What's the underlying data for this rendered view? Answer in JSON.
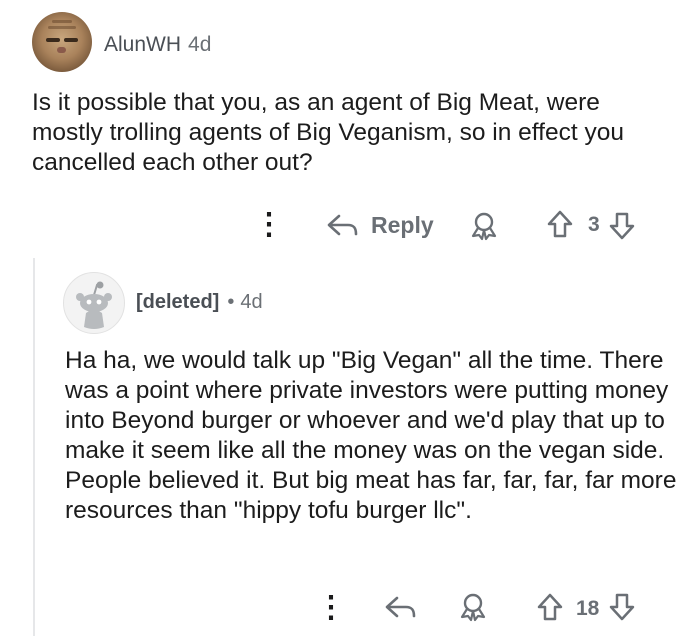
{
  "comment": {
    "username": "AlunWH",
    "age": "4d",
    "body": "Is it possible that you, as an agent of Big Meat, were mostly trolling agents of Big Veganism, so in effect you cancelled each other out?",
    "actions": {
      "more": "⋮",
      "reply_label": "Reply",
      "vote_count": "3"
    }
  },
  "reply": {
    "username": "[deleted]",
    "separator": "•",
    "age": "4d",
    "body": "Ha ha, we would talk up \"Big Vegan\" all the time. There was a point where private investors were putting money into Beyond burger or whoever and we'd play that up to make it seem like all the money was on the vegan side. People believed it. But big meat has far, far, far, far more resources than \"hippy tofu burger llc\".",
    "actions": {
      "more": "⋮",
      "vote_count": "18"
    }
  },
  "colors": {
    "text": "#1c1c1c",
    "meta": "#6a6f75",
    "thread_line": "#e6e7e9"
  }
}
